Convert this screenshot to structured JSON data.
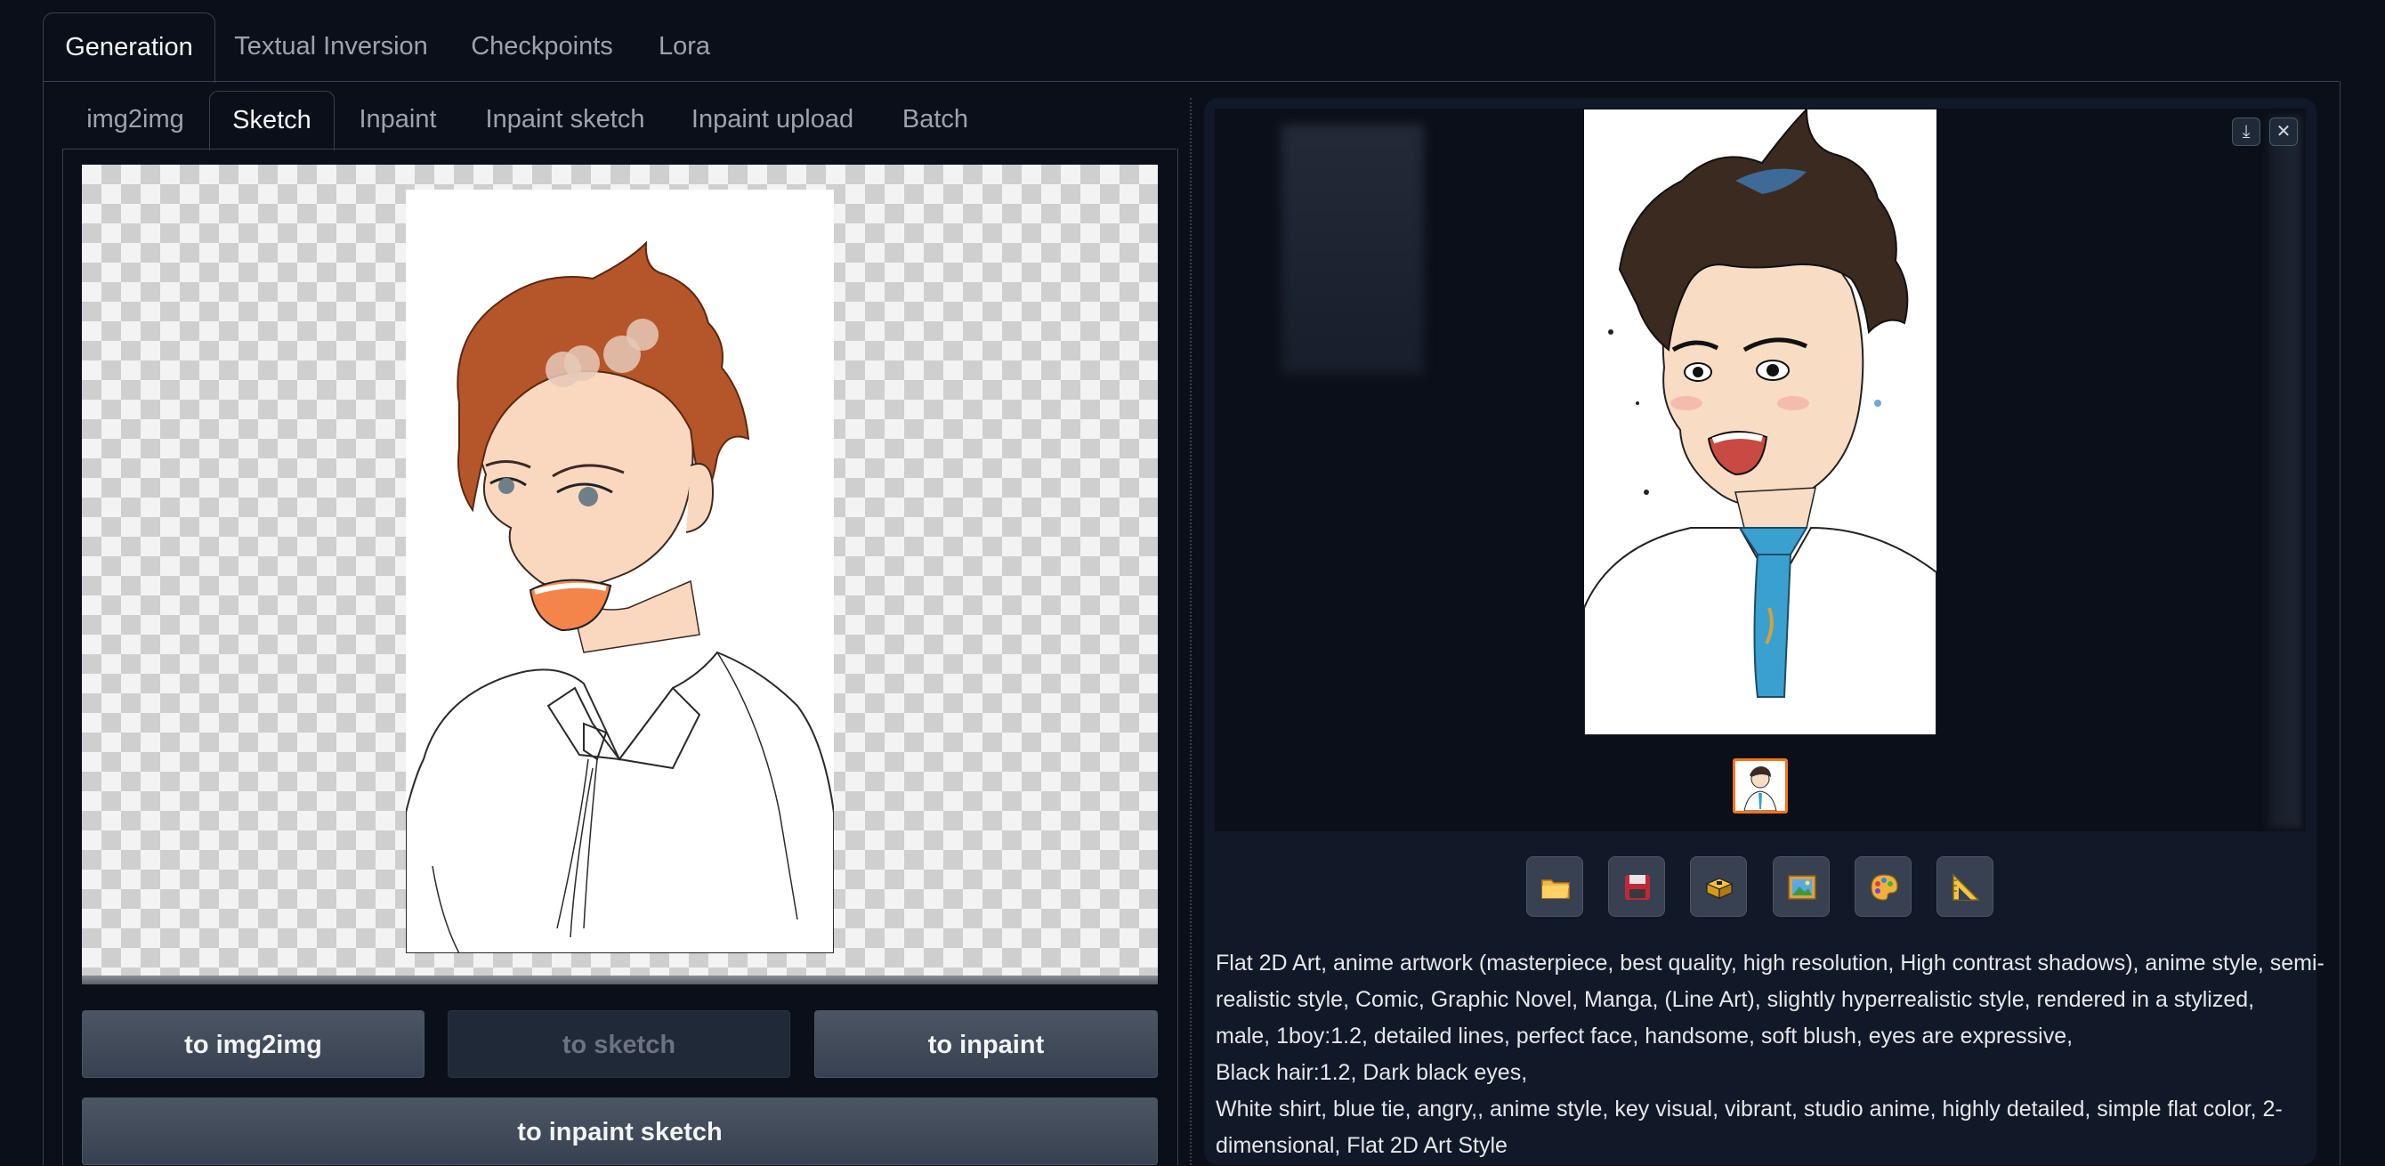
{
  "top_tabs": [
    {
      "label": "Generation",
      "active": true
    },
    {
      "label": "Textual Inversion",
      "active": false
    },
    {
      "label": "Checkpoints",
      "active": false
    },
    {
      "label": "Lora",
      "active": false
    }
  ],
  "sub_tabs": [
    {
      "label": "img2img",
      "active": false
    },
    {
      "label": "Sketch",
      "active": true
    },
    {
      "label": "Inpaint",
      "active": false
    },
    {
      "label": "Inpaint sketch",
      "active": false
    },
    {
      "label": "Inpaint upload",
      "active": false
    },
    {
      "label": "Batch",
      "active": false
    }
  ],
  "buttons": {
    "to_img2img": "to img2img",
    "to_sketch": "to sketch",
    "to_inpaint": "to inpaint",
    "to_inpaint_sketch": "to inpaint sketch"
  },
  "image_corner_icons": [
    "download-icon",
    "close-icon"
  ],
  "tool_icons": [
    "folder-icon",
    "save-icon",
    "zip-icon",
    "image-icon",
    "palette-icon",
    "ruler-icon"
  ],
  "prompt_lines": [
    "Flat 2D Art, anime artwork (masterpiece, best quality, high resolution, High contrast shadows), anime style, semi-",
    "realistic style, Comic, Graphic Novel, Manga, (Line Art), slightly hyperrealistic style, rendered in a stylized,",
    "male, 1boy:1.2, detailed lines, perfect face, handsome, soft blush, eyes are expressive,",
    "Black hair:1.2, Dark black eyes,",
    "White shirt, blue tie, angry,, anime style, key visual, vibrant, studio anime, highly detailed, simple flat color, 2-",
    "dimensional, Flat 2D Art Style"
  ],
  "colors": {
    "background": "#0b0f19",
    "panel": "#111827",
    "accent_thumb_border": "#f97316"
  }
}
